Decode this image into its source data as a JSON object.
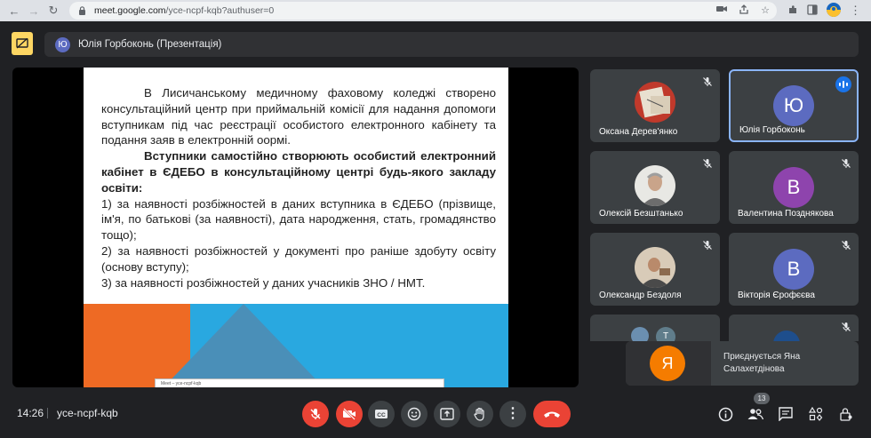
{
  "browser": {
    "url_host": "meet.google.com",
    "url_path": "/yce-ncpf-kqb?authuser=0"
  },
  "meeting": {
    "presenter_initial": "Ю",
    "presentation_title": "Юлія Горбоконь (Презентація)",
    "time": "14:26",
    "code": "yce-ncpf-kqb",
    "participant_count": "13"
  },
  "slide": {
    "paragraph1": "В Лисичанському медичному фаховому коледжі створено консультаційний центр при приймальній комісії для надання допомоги вступникам під час реєстрації особистого електронного кабінету та подання заяв в електронній оормі.",
    "paragraph2": "Вступники самостійно створюють особистий електронний кабінет в ЄДЕБО в консультаційному центрі будь-якого закладу освіти:",
    "item1": "1) за наявності розбіжностей в даних вступника в ЄДЕБО (прізвище, ім'я, по батькові (за наявності), дата народження, стать, громадянство тощо);",
    "item2": "2) за наявності розбіжностей у документі про раніше здобуту освіту (основу вступу);",
    "item3": "3) за наявності розбіжностей у даних учасників ЗНО / НМТ.",
    "mini_window_title": "Meet – yce-ncpf-kqb"
  },
  "participants": [
    {
      "name": "Оксана Дерев'янко",
      "type": "photo"
    },
    {
      "name": "Юлія Горбоконь",
      "initial": "Ю",
      "type": "letter",
      "color": "#5c6bc0"
    },
    {
      "name": "Олексій Безштанько",
      "type": "photo"
    },
    {
      "name": "Валентина Позднякова",
      "initial": "В",
      "type": "letter",
      "color": "#8e44ad"
    },
    {
      "name": "Олександр Бездоля",
      "type": "photo"
    },
    {
      "name": "Вікторія Єрофєєва",
      "initial": "В",
      "type": "letter",
      "color": "#5c6bc0"
    }
  ],
  "partial_tile_initial": "T",
  "toast": {
    "initial": "Я",
    "text": "Приєднується Яна Салахетдінова"
  }
}
